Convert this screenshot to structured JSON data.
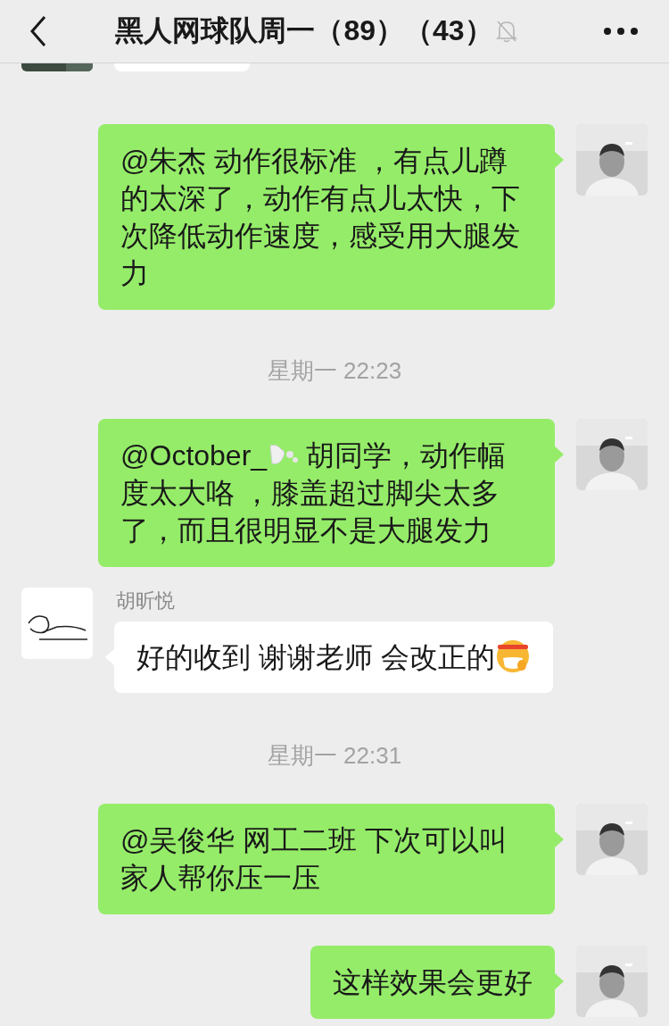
{
  "header": {
    "title": "黑人网球队周一（89）（43）",
    "muted": true
  },
  "messages": [
    {
      "kind": "incoming-cut"
    },
    {
      "kind": "outgoing",
      "lines": [
        [
          "@朱杰 动作很标准 ，有点儿蹲的太深了，动作有点儿太快，下次降低动作速度，感受用大腿发力"
        ]
      ]
    },
    {
      "kind": "time",
      "text": "星期一 22:23"
    },
    {
      "kind": "outgoing",
      "lines": [
        [
          "@October_",
          "胡同学，动作幅"
        ],
        [
          "度太大咯 ，膝盖超过脚尖太多了，而且很明显不是大腿发力"
        ]
      ]
    },
    {
      "kind": "incoming",
      "sender": "胡昕悦",
      "lines": [
        [
          "好的收到 谢谢老师 会改正的"
        ]
      ],
      "ends_with_emoji": true
    },
    {
      "kind": "time",
      "text": "星期一 22:31"
    },
    {
      "kind": "outgoing",
      "lines": [
        [
          "@吴俊华 网工二班 下次可以叫家人帮你压一压"
        ]
      ]
    },
    {
      "kind": "outgoing",
      "lines": [
        [
          "这样效果会更好"
        ]
      ]
    }
  ]
}
